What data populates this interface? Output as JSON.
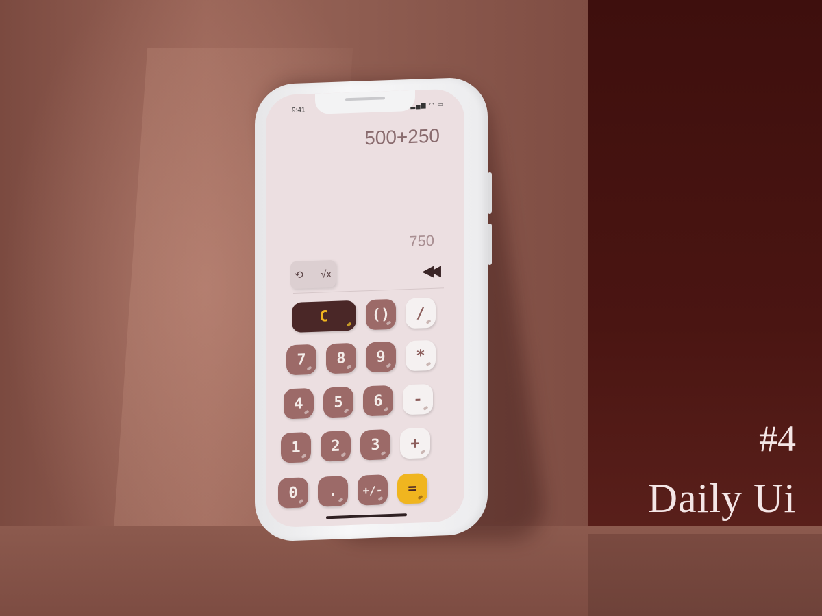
{
  "caption": {
    "number": "#4",
    "title": "Daily Ui"
  },
  "status_bar": {
    "time": "9:41"
  },
  "display": {
    "expression": "500+250",
    "result": "750"
  },
  "tools": {
    "history_icon": "history-icon",
    "function_icon": "sqrt-icon",
    "backspace_icon": "double-chevron-left-icon"
  },
  "keys": {
    "clear": "C",
    "parens": "()",
    "divide": "/",
    "multiply": "*",
    "subtract": "-",
    "add": "+",
    "equals": "=",
    "seven": "7",
    "eight": "8",
    "nine": "9",
    "four": "4",
    "five": "5",
    "six": "6",
    "one": "1",
    "two": "2",
    "three": "3",
    "zero": "0",
    "dot": ".",
    "negate": "+/-"
  },
  "colors": {
    "number_key": "#9c6a68",
    "operator_key": "#f5f1f1",
    "clear_key": "#4a2727",
    "accent": "#f0b51f",
    "screen": "#ecdfe1"
  }
}
